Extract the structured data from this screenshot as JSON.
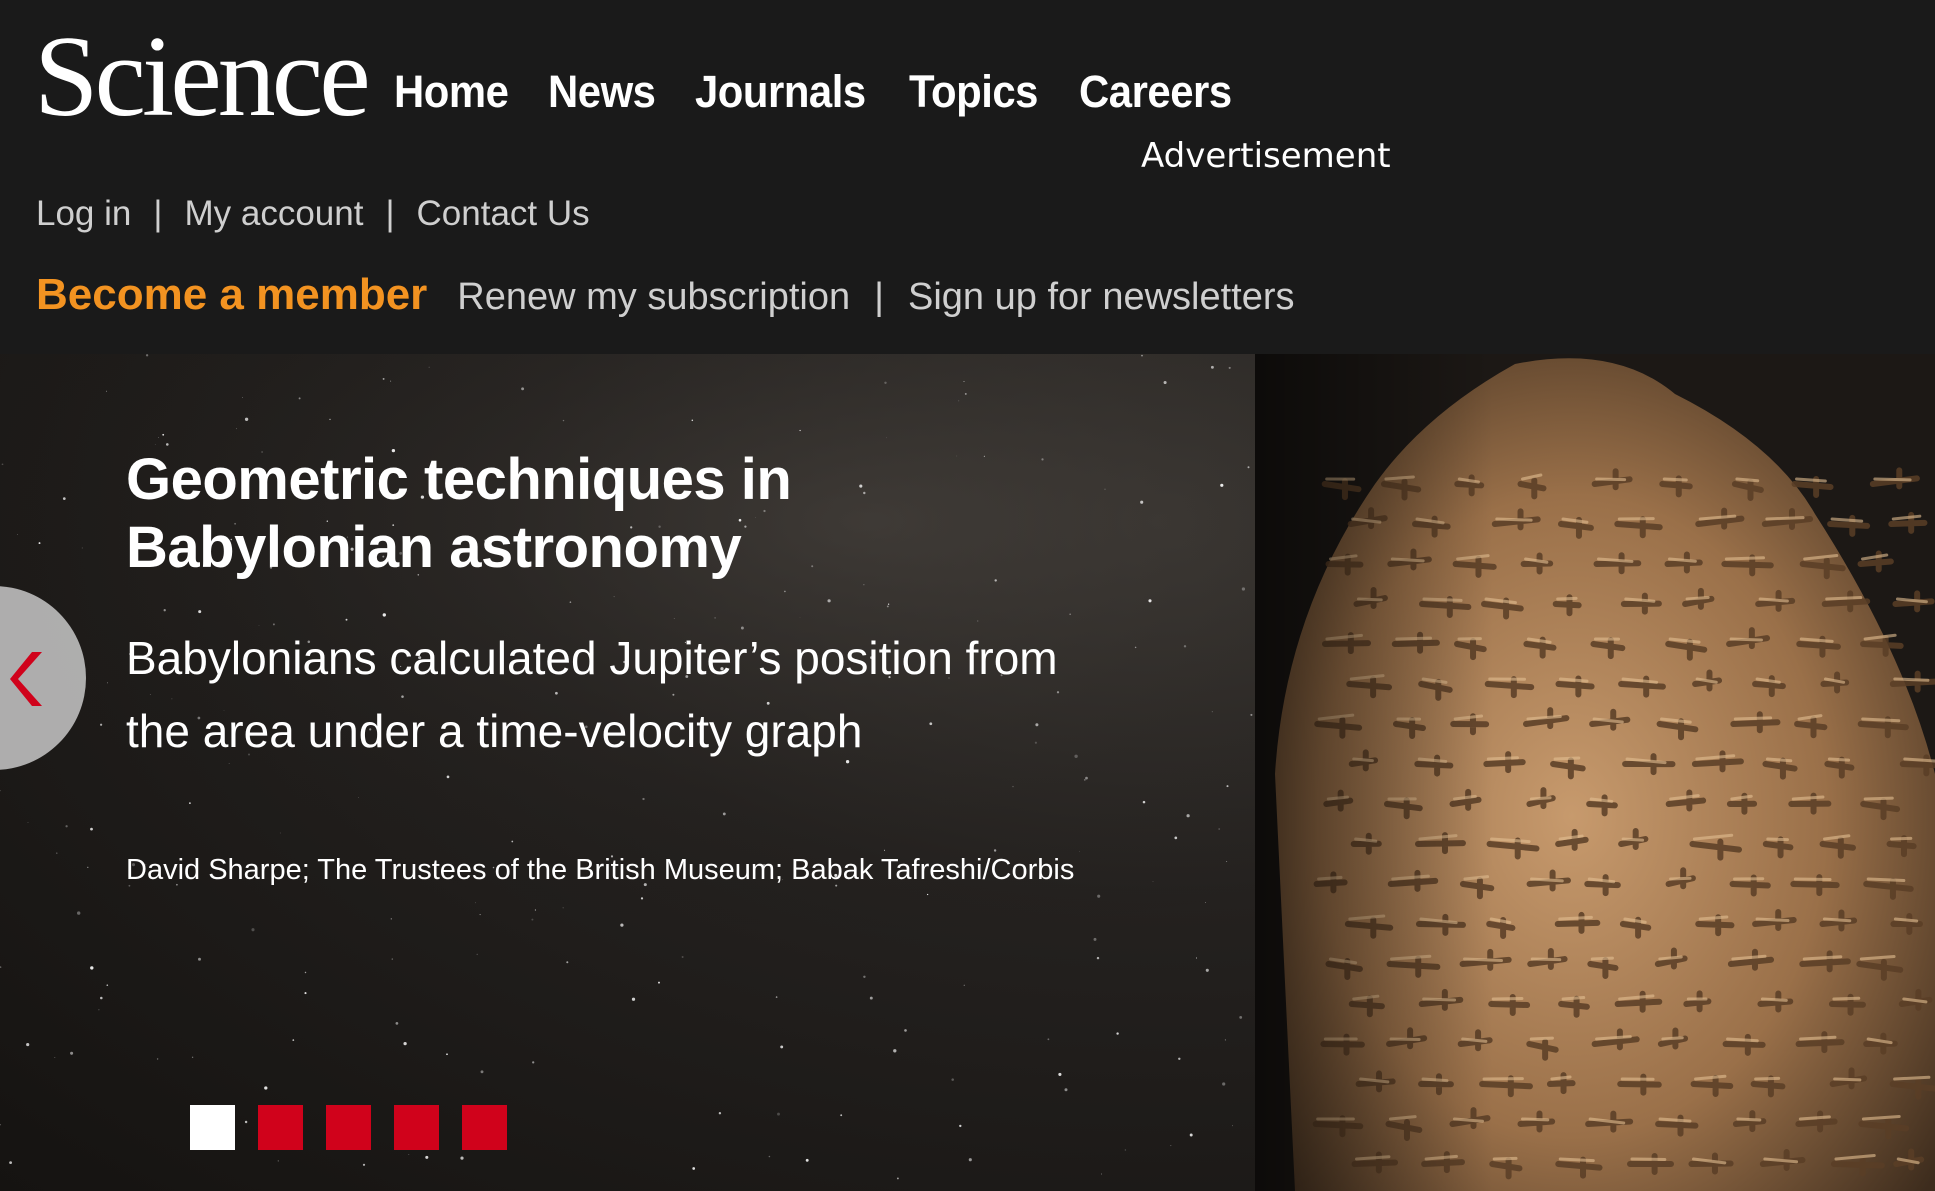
{
  "brand": {
    "logo_text": "Science"
  },
  "main_nav": {
    "items": [
      {
        "label": "Home"
      },
      {
        "label": "News"
      },
      {
        "label": "Journals"
      },
      {
        "label": "Topics"
      },
      {
        "label": "Careers"
      }
    ]
  },
  "advertisement_label": "Advertisement",
  "utility_nav": {
    "login": "Log in",
    "account": "My account",
    "contact": "Contact Us",
    "separator": "|"
  },
  "member_nav": {
    "become_member": "Become a member",
    "renew": "Renew my subscription",
    "newsletters": "Sign up for newsletters",
    "separator": "|"
  },
  "hero": {
    "title": "Geometric techniques in Babylonian astronomy",
    "description": "Babylonians calculated Jupiter’s position from the area under a time-velocity graph",
    "credit": "David Sharpe; The Trustees of the British Museum; Babak Tafreshi/Corbis",
    "prev_icon": "chevron-left-icon",
    "slide_count": 5,
    "active_slide": 1
  },
  "colors": {
    "header_bg": "#1a1a1a",
    "accent_orange": "#f39321",
    "indicator_red": "#d0021b",
    "text_white": "#ffffff"
  }
}
